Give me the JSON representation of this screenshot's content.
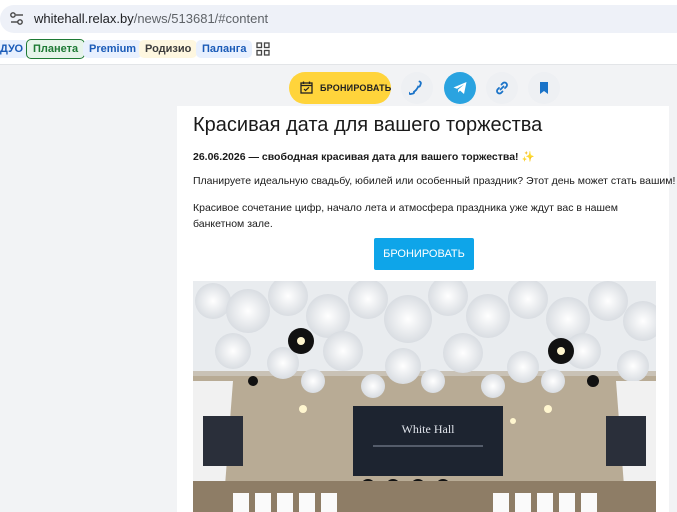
{
  "browser": {
    "url_host": "whitehall.relax.by",
    "url_path": "/news/513681/#content"
  },
  "bookmarks": [
    {
      "label": "ДУО",
      "bg": "#e8f0fe",
      "color": "#1a5bb8"
    },
    {
      "label": "Планета",
      "bg": "#e6f4ea",
      "color": "#1e7a34"
    },
    {
      "label": "Premium",
      "bg": "#e8f0fe",
      "color": "#1a5bb8"
    },
    {
      "label": "Родизио",
      "bg": "#fef7e0",
      "color": "#3c3c3c"
    },
    {
      "label": "Паланга",
      "bg": "#e8f0fe",
      "color": "#1a5bb8"
    }
  ],
  "action_bar": {
    "book_label": "БРОНИРОВАТЬ",
    "icons": [
      "phone-icon",
      "telegram-icon",
      "link-icon",
      "bookmark-icon"
    ]
  },
  "article": {
    "title": "Красивая дата для вашего торжества",
    "lead": "26.06.2026 — свободная красивая дата для вашего торжества!",
    "lead_emoji": "✨",
    "paragraph1": "Планируете идеальную свадьбу, юбилей или особенный праздник? Этот день может стать вашим!",
    "paragraph2": "Красивое сочетание цифр, начало лета и атмосфера праздника уже ждут вас в нашем банкетном зале.",
    "book_button": "БРОНИРОВАТЬ",
    "photo_sign": "White Hall"
  },
  "colors": {
    "accent_yellow": "#ffd43b",
    "accent_blue": "#0ea5e9",
    "telegram": "#2aa3e0"
  }
}
